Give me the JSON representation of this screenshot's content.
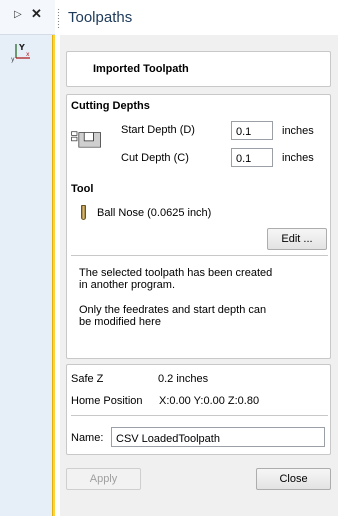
{
  "left_panel": {
    "pin_glyph": "▷",
    "close_glyph": "✕",
    "axis_icon": "axis-xyz-icon"
  },
  "header": {
    "title": "Toolpaths"
  },
  "toolpath_heading": "Imported Toolpath",
  "cutting_depths": {
    "title": "Cutting Depths",
    "start_depth_label": "Start Depth (D)",
    "start_depth_value": "0.1",
    "start_depth_unit": "inches",
    "cut_depth_label": "Cut Depth (C)",
    "cut_depth_value": "0.1",
    "cut_depth_unit": "inches"
  },
  "tool": {
    "title": "Tool",
    "name": "Ball Nose (0.0625 inch)",
    "edit_label": "Edit ..."
  },
  "messages": {
    "line1": "The selected toolpath has been created",
    "line2": "in another program.",
    "line3": "Only the feedrates and start depth can",
    "line4": "be modified here"
  },
  "info": {
    "safe_z_label": "Safe Z",
    "safe_z_value": "0.2 inches",
    "home_label": "Home Position",
    "home_value": "X:0.00 Y:0.00 Z:0.80",
    "name_label": "Name:",
    "name_value": "CSV LoadedToolpath"
  },
  "buttons": {
    "apply": "Apply",
    "close": "Close"
  },
  "colors": {
    "left_strip": "#e6eef8",
    "accent_divider": "#ffd23a",
    "panel_bg": "#f0f0f0",
    "title_text": "#1e3a5a"
  }
}
